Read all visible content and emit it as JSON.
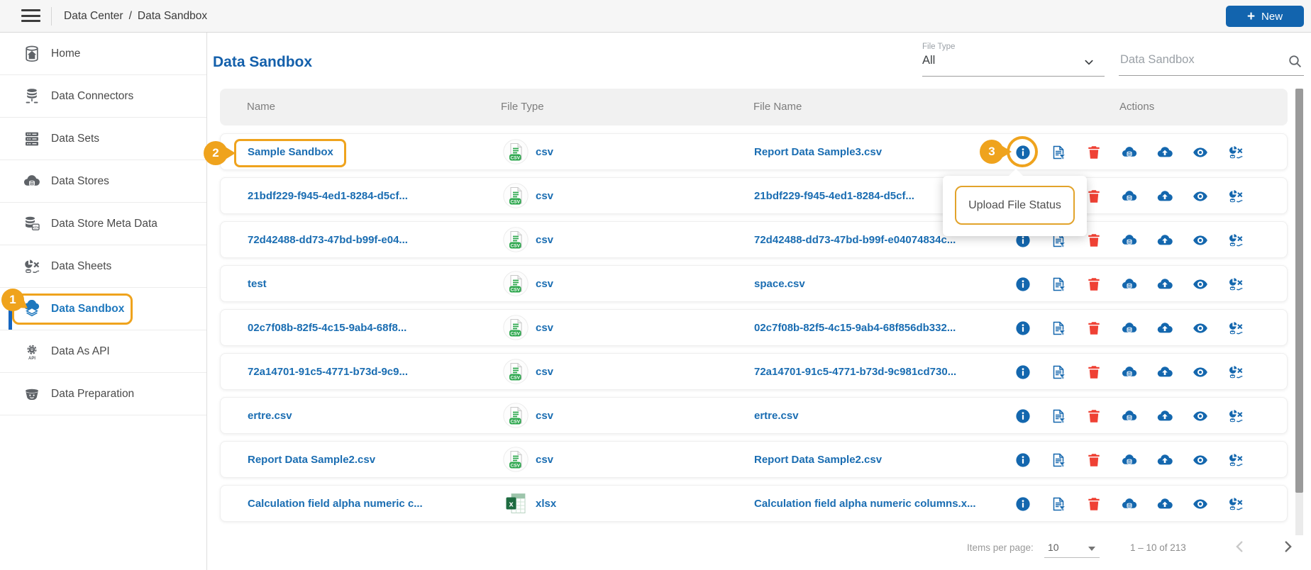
{
  "topbar": {
    "breadcrumb": [
      "Data Center",
      "Data Sandbox"
    ],
    "breadcrumb_separator": "/",
    "new_plus": "+",
    "new_label": "New"
  },
  "sidebar": {
    "items": [
      {
        "label": "Home",
        "icon": "home",
        "active": false
      },
      {
        "label": "Data Connectors",
        "icon": "data-connectors",
        "active": false
      },
      {
        "label": "Data Sets",
        "icon": "data-sets",
        "active": false
      },
      {
        "label": "Data Stores",
        "icon": "data-stores",
        "active": false
      },
      {
        "label": "Data Store Meta Data",
        "icon": "data-store-meta-data",
        "active": false
      },
      {
        "label": "Data Sheets",
        "icon": "data-sheets",
        "active": false
      },
      {
        "label": "Data Sandbox",
        "icon": "data-sandbox",
        "active": true
      },
      {
        "label": "Data As API",
        "icon": "data-as-api",
        "active": false
      },
      {
        "label": "Data Preparation",
        "icon": "data-preparation",
        "active": false
      }
    ]
  },
  "page": {
    "title": "Data Sandbox"
  },
  "filters": {
    "file_type_label": "File Type",
    "file_type_value": "All",
    "search_placeholder": "Data Sandbox"
  },
  "table": {
    "columns": [
      "Name",
      "File Type",
      "File Name",
      "Actions"
    ],
    "action_icons": [
      "info",
      "file-filter",
      "delete",
      "cloud-data",
      "cloud-upload",
      "view",
      "data-sheet"
    ],
    "rows": [
      {
        "name": "Sample Sandbox",
        "file_type": "csv",
        "file_name": "Report Data Sample3.csv"
      },
      {
        "name": "21bdf229-f945-4ed1-8284-d5cf...",
        "file_type": "csv",
        "file_name": "21bdf229-f945-4ed1-8284-d5cf..."
      },
      {
        "name": "72d42488-dd73-47bd-b99f-e04...",
        "file_type": "csv",
        "file_name": "72d42488-dd73-47bd-b99f-e04074834c..."
      },
      {
        "name": "test",
        "file_type": "csv",
        "file_name": "space.csv"
      },
      {
        "name": "02c7f08b-82f5-4c15-9ab4-68f8...",
        "file_type": "csv",
        "file_name": "02c7f08b-82f5-4c15-9ab4-68f856db332..."
      },
      {
        "name": "72a14701-91c5-4771-b73d-9c9...",
        "file_type": "csv",
        "file_name": "72a14701-91c5-4771-b73d-9c981cd730..."
      },
      {
        "name": "ertre.csv",
        "file_type": "csv",
        "file_name": "ertre.csv"
      },
      {
        "name": "Report Data Sample2.csv",
        "file_type": "csv",
        "file_name": "Report Data Sample2.csv"
      },
      {
        "name": "Calculation field alpha numeric c...",
        "file_type": "xlsx",
        "file_name": "Calculation field alpha numeric columns.x..."
      }
    ]
  },
  "annotations": {
    "callouts": [
      {
        "label": "1"
      },
      {
        "label": "2"
      },
      {
        "label": "3"
      }
    ],
    "tooltip_text": "Upload File Status"
  },
  "pagination": {
    "items_per_page_label": "Items per page:",
    "items_per_page_value": "10",
    "range_label": "1 – 10 of 213"
  },
  "colors": {
    "accent_blue": "#1264ae",
    "link_blue": "#1a6db2",
    "icon_blue": "#1467ae",
    "annotation_orange": "#efa31d",
    "csv_green": "#2fa84f",
    "delete_red": "#ef4134"
  }
}
